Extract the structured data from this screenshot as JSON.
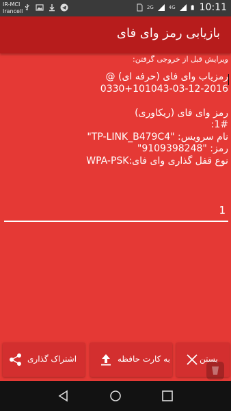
{
  "status_bar": {
    "carrier_line1": "IR-MCI",
    "carrier_line2": "Irancell",
    "network_left": "2G",
    "network_right": "4G",
    "time": "10:11",
    "icons": [
      "usb-icon",
      "image-icon",
      "download-icon",
      "telegram-icon",
      "sim-icon",
      "signal-icon",
      "battery-icon"
    ]
  },
  "app_bar": {
    "title": "بازیابی رمز وای فای",
    "color": "#b71c1c"
  },
  "hint": "ویرایش قبل از خروجی گرفتن:",
  "editor": {
    "lines": [
      "رمزیاب وای فای (حرفه ای) @",
      "0330+101043-03-12-2016",
      "",
      "رمز وای فای (ریکاوری)",
      ":1#",
      "نام سرویس:   \"TP-LINK_B479C4\"",
      "رمز:   \"9109398248\"",
      "نوع قفل گذاری وای فای:WPA-PSK"
    ],
    "page_value": "1"
  },
  "buttons": {
    "share": "اشتراک گذاری",
    "sd_card": "به کارت حافظه",
    "close": "بستن"
  },
  "colors": {
    "background": "#e53935",
    "button": "#d32f2f"
  }
}
